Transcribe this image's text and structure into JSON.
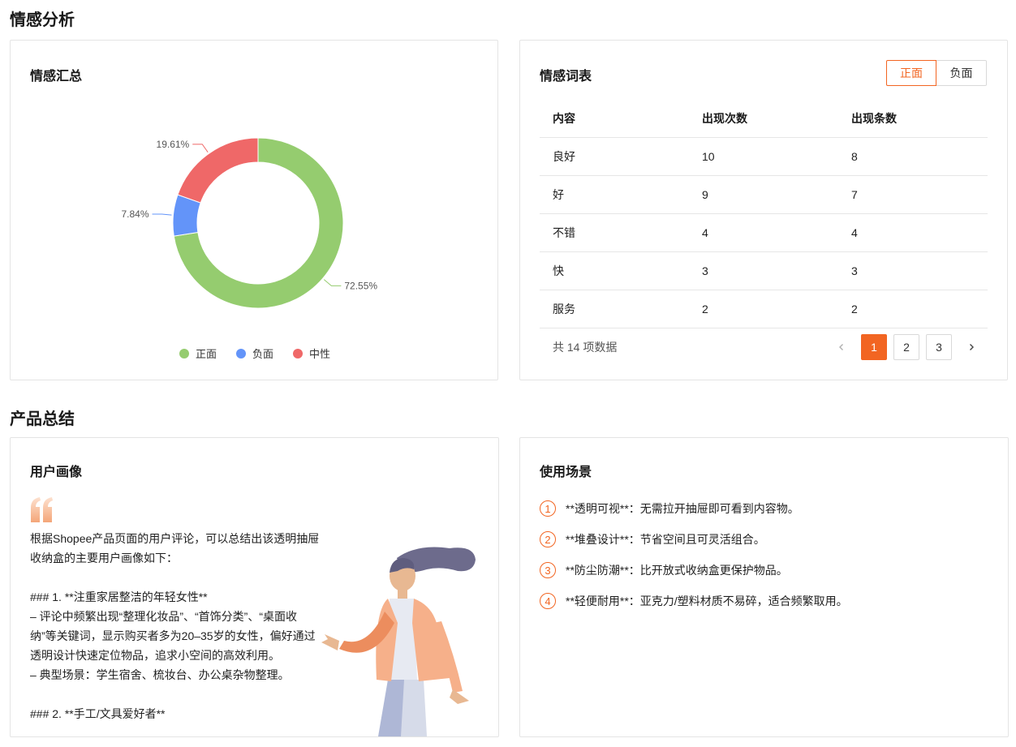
{
  "sentiment_section": {
    "title": "情感分析"
  },
  "summary_card": {
    "title": "情感汇总",
    "legend": [
      {
        "label": "正面",
        "color": "#95cc6f"
      },
      {
        "label": "负面",
        "color": "#6394f9"
      },
      {
        "label": "中性",
        "color": "#ef6868"
      }
    ]
  },
  "chart_data": {
    "type": "pie",
    "donut": true,
    "title": "",
    "legend_position": "bottom",
    "categories": [
      "正面",
      "负面",
      "中性"
    ],
    "values": [
      72.55,
      7.84,
      19.61
    ],
    "labels": [
      "72.55%",
      "7.84%",
      "19.61%"
    ],
    "colors": [
      "#95cc6f",
      "#6394f9",
      "#ef6868"
    ]
  },
  "wordlist_card": {
    "title": "情感词表",
    "toggle": {
      "positive": "正面",
      "negative": "负面",
      "active": "正面"
    },
    "columns": [
      "内容",
      "出现次数",
      "出现条数"
    ],
    "rows": [
      [
        "良好",
        "10",
        "8"
      ],
      [
        "好",
        "9",
        "7"
      ],
      [
        "不错",
        "4",
        "4"
      ],
      [
        "快",
        "3",
        "3"
      ],
      [
        "服务",
        "2",
        "2"
      ]
    ],
    "pagination": {
      "total_text": "共 14 项数据",
      "pages": [
        "1",
        "2",
        "3"
      ],
      "current": "1",
      "prev_icon": "chevron-left-icon",
      "next_icon": "chevron-right-icon"
    }
  },
  "product_section": {
    "title": "产品总结"
  },
  "persona_card": {
    "title": "用户画像",
    "quote_icon": "quote-icon",
    "text": "根据Shopee产品页面的用户评论，可以总结出该透明抽屉收纳盒的主要用户画像如下：\n\n### 1. **注重家居整洁的年轻女性**\n– 评论中频繁出现“整理化妆品”、“首饰分类”、“桌面收纳”等关键词，显示购买者多为20–35岁的女性，偏好通过透明设计快速定位物品，追求小空间的高效利用。\n– 典型场景：学生宿舍、梳妆台、办公桌杂物整理。\n\n### 2. **手工/文具爱好者**"
  },
  "scenario_card": {
    "title": "使用场景",
    "items": [
      {
        "num": "1",
        "text": "**透明可视**：无需拉开抽屉即可看到内容物。"
      },
      {
        "num": "2",
        "text": "**堆叠设计**：节省空间且可灵活组合。"
      },
      {
        "num": "3",
        "text": "**防尘防潮**：比开放式收纳盒更保护物品。"
      },
      {
        "num": "4",
        "text": "**轻便耐用**：亚克力/塑料材质不易碎，适合频繁取用。"
      }
    ]
  }
}
